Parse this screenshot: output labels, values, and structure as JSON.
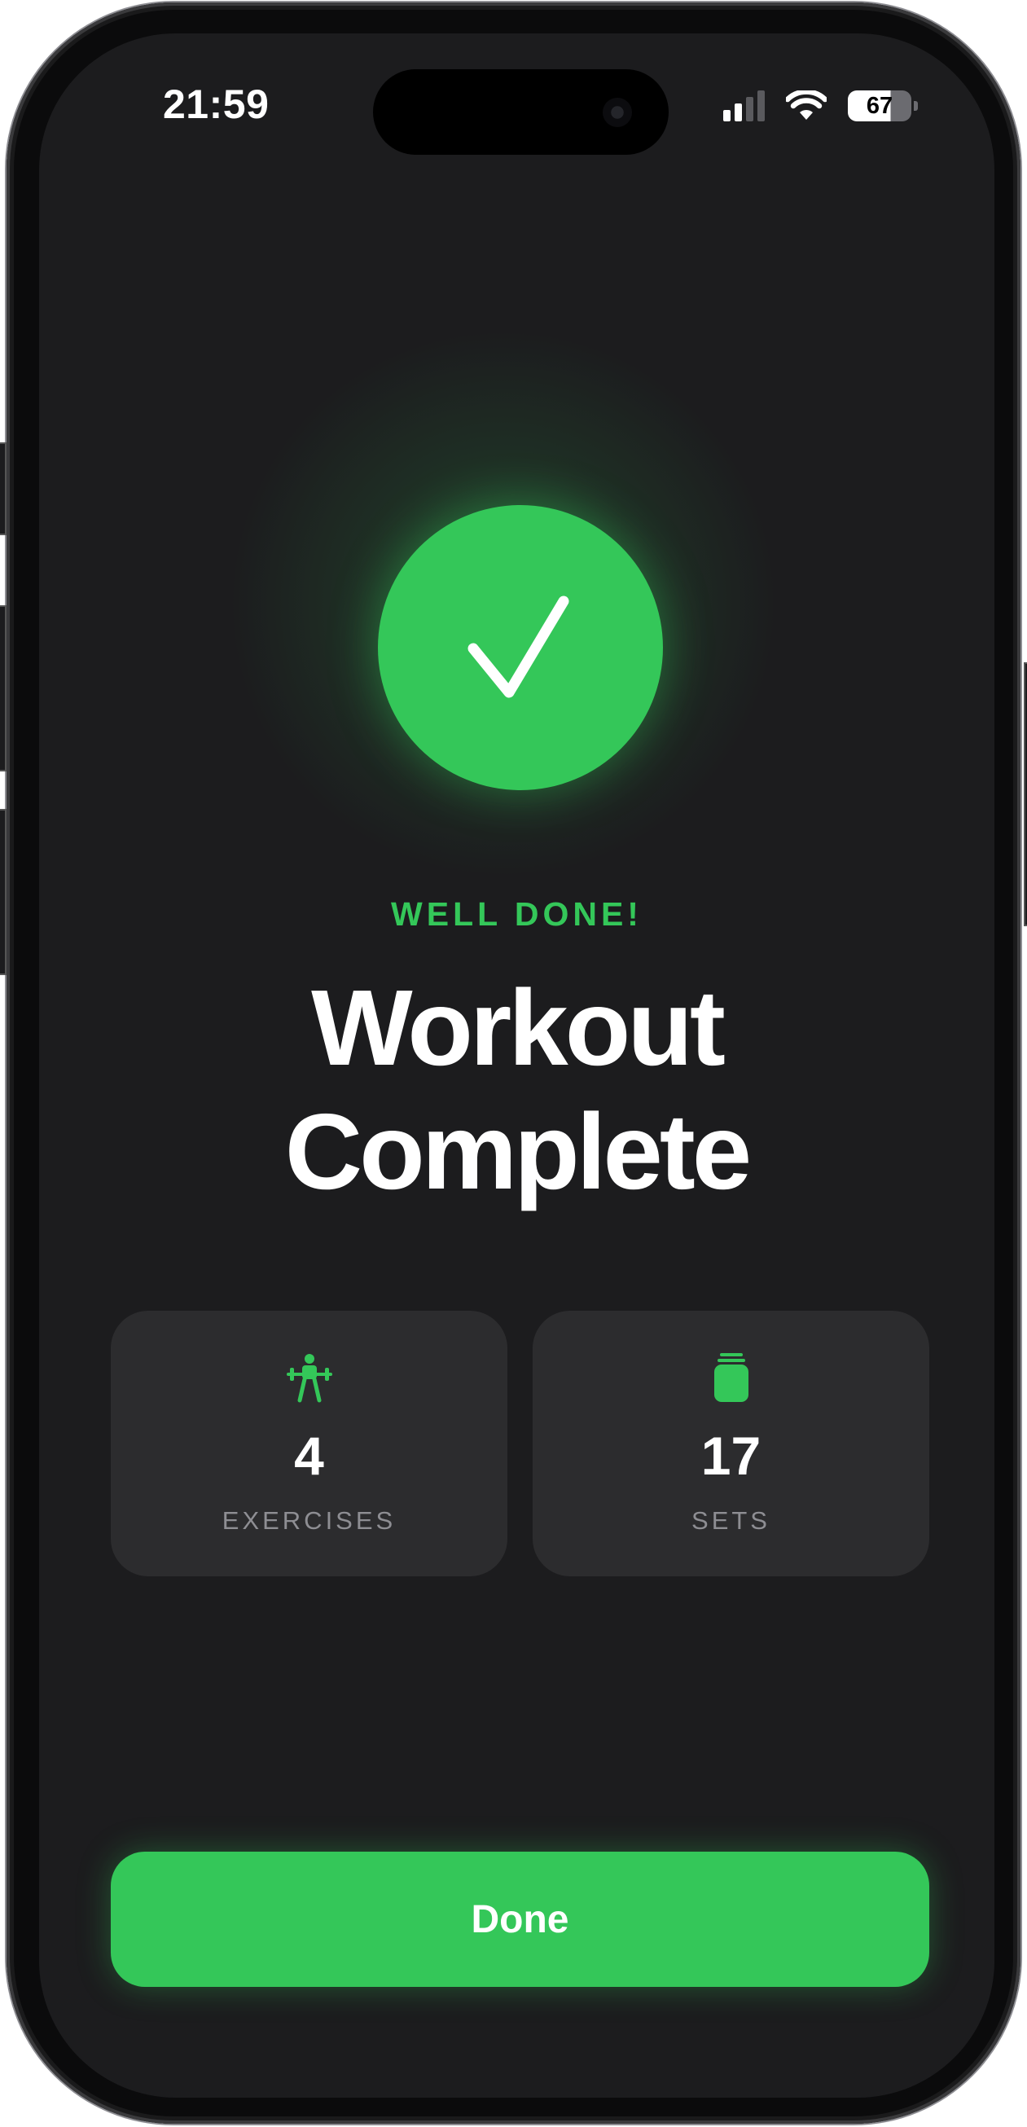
{
  "status_bar": {
    "time": "21:59",
    "battery_percent": "67",
    "signal_bars_active": 2,
    "icons": [
      "cellular-signal-icon",
      "wifi-icon",
      "battery-icon"
    ]
  },
  "hero": {
    "icon": "checkmark-icon",
    "kicker": "WELL DONE!",
    "title_line1": "Workout",
    "title_line2": "Complete"
  },
  "stats": [
    {
      "icon": "weightlifter-icon",
      "value": "4",
      "label": "EXERCISES"
    },
    {
      "icon": "stacked-plates-icon",
      "value": "17",
      "label": "SETS"
    }
  ],
  "actions": {
    "done_label": "Done"
  },
  "colors": {
    "accent": "#34c759",
    "background": "#1c1c1e",
    "card": "#2c2c2e",
    "label_gray": "#8e8e93",
    "text": "#ffffff"
  }
}
